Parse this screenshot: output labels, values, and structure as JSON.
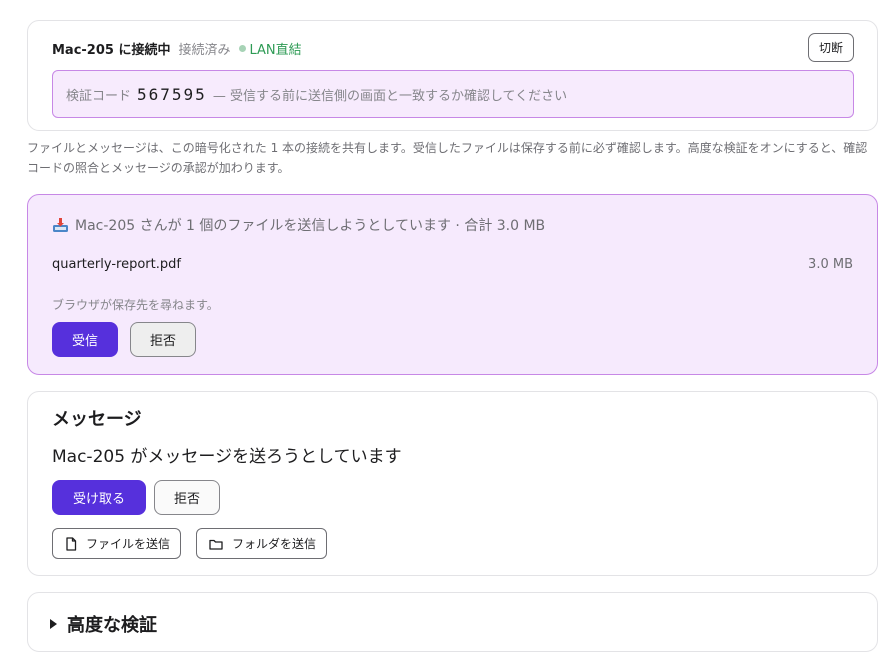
{
  "connection": {
    "peer_label": "Mac-205 に接続中",
    "state": "接続済み",
    "lan_label": "LAN直結",
    "disconnect_label": "切断",
    "verify_prefix": "検証コード",
    "verify_code": "567595",
    "verify_suffix": "— 受信する前に送信側の画面と一致するか確認してください"
  },
  "description": "ファイルとメッセージは、この暗号化された 1 本の接続を共有します。受信したファイルは保存する前に必ず確認します。高度な検証をオンにすると、確認コードの照合とメッセージの承認が加わります。",
  "incoming": {
    "title": "Mac-205 さんが 1 個のファイルを送信しようとしています · 合計 3.0 MB",
    "file_name": "quarterly-report.pdf",
    "file_size": "3.0 MB",
    "save_note": "ブラウザが保存先を尋ねます。",
    "accept_label": "受信",
    "reject_label": "拒否"
  },
  "message": {
    "heading": "メッセージ",
    "text": "Mac-205 がメッセージを送ろうとしています",
    "accept_label": "受け取る",
    "reject_label": "拒否",
    "send_file_label": "ファイルを送信",
    "send_folder_label": "フォルダを送信"
  },
  "advanced": {
    "title": "高度な検証"
  },
  "icons": {
    "incoming": "inbox-tray-icon",
    "send_file": "file-icon",
    "send_folder": "folder-icon",
    "lan_status": "status-dot-icon",
    "advanced_toggle": "disclosure-triangle-icon"
  },
  "colors": {
    "accent": "#5630dc",
    "lan_green": "#2e9b55",
    "highlight_bg": "#f7ebfd",
    "highlight_border": "#c788e6"
  }
}
